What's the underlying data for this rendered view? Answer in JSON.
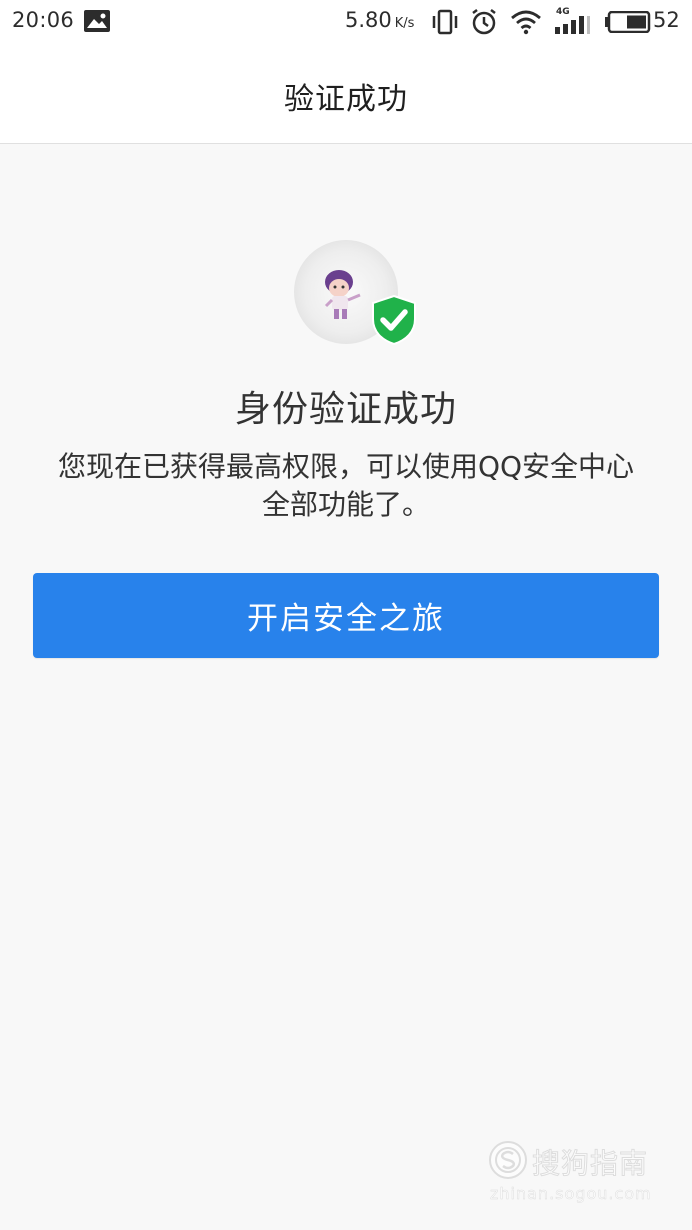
{
  "status_bar": {
    "time": "20:06",
    "net_speed": "5.80",
    "net_speed_unit": "K/s",
    "network_type": "4G",
    "battery_level": "52",
    "icons": [
      "gallery-icon",
      "vibrate-icon",
      "alarm-icon",
      "wifi-icon",
      "cell-signal-icon",
      "battery-icon"
    ]
  },
  "nav": {
    "title": "验证成功"
  },
  "result": {
    "title": "身份验证成功",
    "desc_line1": "您现在已获得最高权限，可以使用QQ安全中心",
    "desc_line2": "全部功能了。"
  },
  "action": {
    "button_label": "开启安全之旅"
  },
  "watermark": {
    "name": "搜狗指南",
    "url": "zhinan.sogou.com"
  },
  "colors": {
    "primary": "#2882eb",
    "verified": "#20b24a",
    "background": "#f8f8f8",
    "header_bg": "#ffffff"
  }
}
